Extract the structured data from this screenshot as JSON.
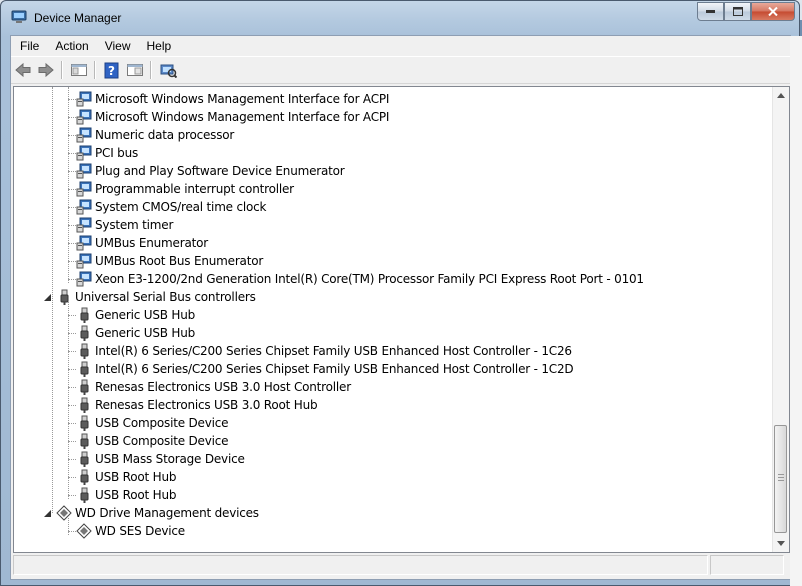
{
  "window": {
    "title": "Device Manager"
  },
  "menu": [
    "File",
    "Action",
    "View",
    "Help"
  ],
  "toolbar": [
    "back-icon",
    "forward-icon",
    "properties-icon",
    "help-icon",
    "show-hidden-icon",
    "scan-hardware-icon"
  ],
  "tree": [
    {
      "label": "Microsoft Windows Management Interface for ACPI",
      "level": 1,
      "icon": "system-device-icon"
    },
    {
      "label": "Microsoft Windows Management Interface for ACPI",
      "level": 1,
      "icon": "system-device-icon"
    },
    {
      "label": "Numeric data processor",
      "level": 1,
      "icon": "system-device-icon"
    },
    {
      "label": "PCI bus",
      "level": 1,
      "icon": "system-device-icon"
    },
    {
      "label": "Plug and Play Software Device Enumerator",
      "level": 1,
      "icon": "system-device-icon"
    },
    {
      "label": "Programmable interrupt controller",
      "level": 1,
      "icon": "system-device-icon"
    },
    {
      "label": "System CMOS/real time clock",
      "level": 1,
      "icon": "system-device-icon"
    },
    {
      "label": "System timer",
      "level": 1,
      "icon": "system-device-icon"
    },
    {
      "label": "UMBus Enumerator",
      "level": 1,
      "icon": "system-device-icon"
    },
    {
      "label": "UMBus Root Bus Enumerator",
      "level": 1,
      "icon": "system-device-icon"
    },
    {
      "label": "Xeon E3-1200/2nd Generation Intel(R) Core(TM) Processor Family PCI Express Root Port - 0101",
      "level": 1,
      "icon": "system-device-icon"
    },
    {
      "label": "Universal Serial Bus controllers",
      "level": 0,
      "icon": "usb-icon",
      "expanded": true
    },
    {
      "label": "Generic USB Hub",
      "level": 1,
      "icon": "usb-icon"
    },
    {
      "label": "Generic USB Hub",
      "level": 1,
      "icon": "usb-icon"
    },
    {
      "label": "Intel(R) 6 Series/C200 Series Chipset Family USB Enhanced Host Controller - 1C26",
      "level": 1,
      "icon": "usb-icon"
    },
    {
      "label": "Intel(R) 6 Series/C200 Series Chipset Family USB Enhanced Host Controller - 1C2D",
      "level": 1,
      "icon": "usb-icon"
    },
    {
      "label": "Renesas Electronics USB 3.0 Host Controller",
      "level": 1,
      "icon": "usb-icon"
    },
    {
      "label": "Renesas Electronics USB 3.0 Root Hub",
      "level": 1,
      "icon": "usb-icon"
    },
    {
      "label": "USB Composite Device",
      "level": 1,
      "icon": "usb-icon"
    },
    {
      "label": "USB Composite Device",
      "level": 1,
      "icon": "usb-icon"
    },
    {
      "label": "USB Mass Storage Device",
      "level": 1,
      "icon": "usb-icon"
    },
    {
      "label": "USB Root Hub",
      "level": 1,
      "icon": "usb-icon"
    },
    {
      "label": "USB Root Hub",
      "level": 1,
      "icon": "usb-icon"
    },
    {
      "label": "WD Drive Management devices",
      "level": 0,
      "icon": "wd-device-icon",
      "expanded": true
    },
    {
      "label": "WD SES Device",
      "level": 1,
      "icon": "wd-device-icon"
    }
  ],
  "colors": {
    "selection": "#cce8ff",
    "titlebar": "#b3c9df",
    "close": "#c54a30"
  }
}
